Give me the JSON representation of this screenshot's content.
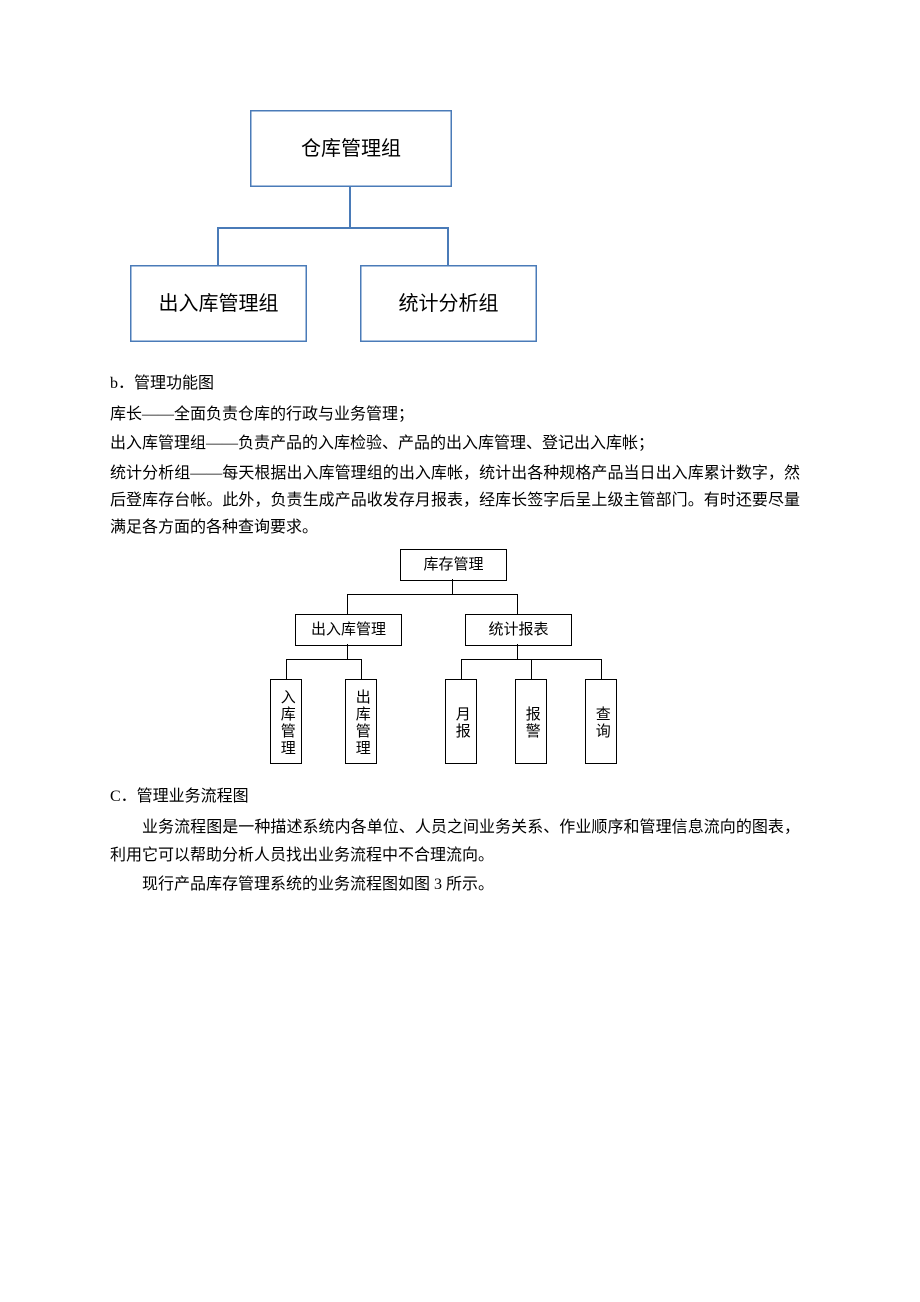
{
  "org": {
    "top": "仓库管理组",
    "left": "出入库管理组",
    "right": "统计分析组"
  },
  "section_b": {
    "title": "b．管理功能图",
    "line1": "库长——全面负责仓库的行政与业务管理；",
    "line2": "出入库管理组——负责产品的入库检验、产品的出入库管理、登记出入库帐；",
    "line3": "统计分析组——每天根据出入库管理组的出入库帐，统计出各种规格产品当日出入库累计数字，然后登库存台帐。此外，负责生成产品收发存月报表，经库长签字后呈上级主管部门。有时还要尽量满足各方面的各种查询要求。"
  },
  "tree": {
    "root": "库存管理",
    "l2a": "出入库管理",
    "l2b": "统计报表",
    "leaves": [
      "入库管理",
      "出库管理",
      "月报",
      "报警",
      "查询"
    ]
  },
  "section_c": {
    "title": "C．管理业务流程图",
    "p1": "业务流程图是一种描述系统内各单位、人员之间业务关系、作业顺序和管理信息流向的图表，利用它可以帮助分析人员找出业务流程中不合理流向。",
    "p2": "现行产品库存管理系统的业务流程图如图 3 所示。"
  }
}
